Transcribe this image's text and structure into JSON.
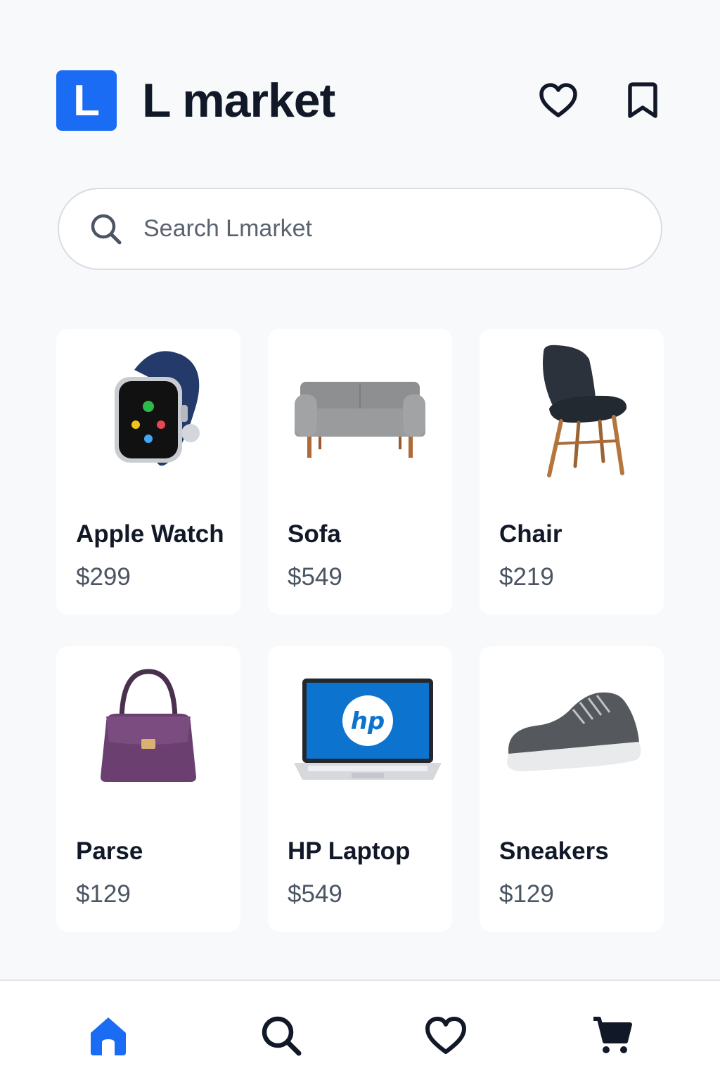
{
  "app": {
    "logo_letter": "L",
    "title": "L market"
  },
  "header": {
    "icons": [
      "heart-icon",
      "bookmark-icon"
    ]
  },
  "search": {
    "placeholder": "Search Lmarket",
    "value": ""
  },
  "products": [
    {
      "name": "Apple Watch",
      "price": "$299",
      "image": "apple-watch-image"
    },
    {
      "name": "Sofa",
      "price": "$549",
      "image": "sofa-image"
    },
    {
      "name": "Chair",
      "price": "$219",
      "image": "chair-image"
    },
    {
      "name": "Parse",
      "price": "$129",
      "image": "purse-image"
    },
    {
      "name": "HP Laptop",
      "price": "$549",
      "image": "laptop-image"
    },
    {
      "name": "Sneakers",
      "price": "$129",
      "image": "sneakers-image"
    }
  ],
  "bottom_nav": {
    "items": [
      "home-icon",
      "search-icon",
      "heart-icon",
      "cart-icon"
    ],
    "active": "home-icon"
  },
  "colors": {
    "accent": "#1a6cf5",
    "text": "#111827",
    "muted": "#4b5563",
    "background": "#f8f9fb"
  }
}
